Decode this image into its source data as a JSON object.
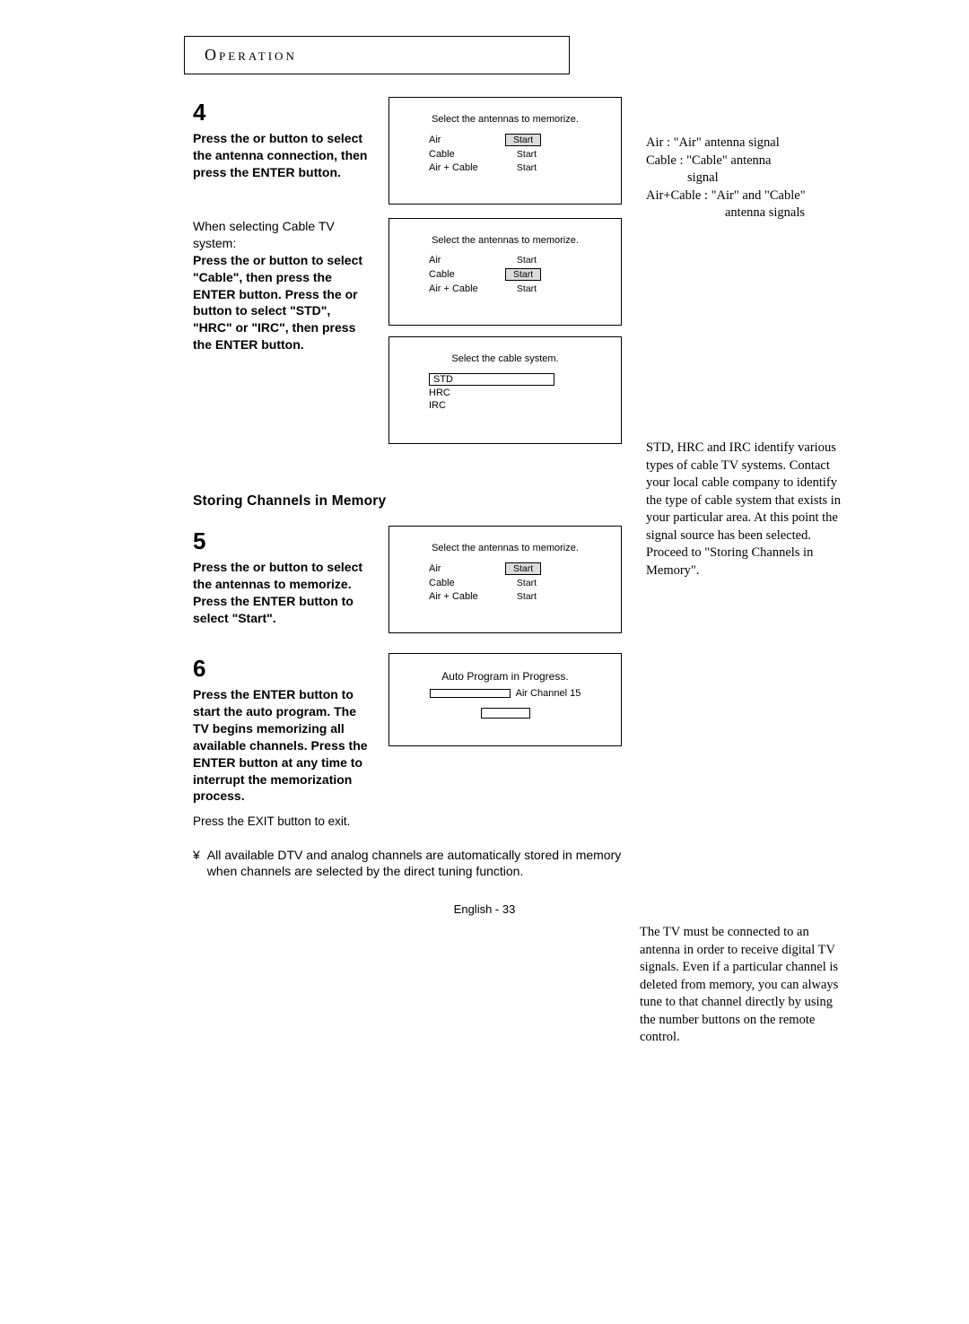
{
  "header": {
    "title": "Operation"
  },
  "sideNote1": {
    "line1": "Air : \"Air\" antenna signal",
    "line2": "Cable : \"Cable\" antenna",
    "line2b": "signal",
    "line3": "Air+Cable : \"Air\" and \"Cable\"",
    "line3b": "antenna signals"
  },
  "sideNote2": "STD, HRC and IRC identify various types of cable TV systems. Contact your local cable company to identify the type of cable system that exists in your particular area. At this point the signal source has been selected. Proceed to \"Storing Channels in Memory\".",
  "sideNote3": "The TV must be connected to an antenna in order to receive digital TV signals. Even if a particular channel is deleted from memory, you can always tune to that channel directly by using the number buttons on the remote control.",
  "step4": {
    "num": "4",
    "text": "Press the    or    button to select the antenna connection, then press the ENTER button."
  },
  "step4b": {
    "line1": "When selecting Cable TV system:",
    "text": "Press the    or    button to select \"Cable\", then press the ENTER button. Press the    or    button to select \"STD\", \"HRC\" or \"IRC\", then press the ENTER button."
  },
  "step5": {
    "num": "5",
    "text": "Press the    or button to select the antennas to memorize. Press the ENTER button to select \"Start\"."
  },
  "step6": {
    "num": "6",
    "text": "Press the ENTER button to start the auto program. The TV begins memorizing all available channels. Press the ENTER button at any time to interrupt the memorization process.",
    "exit": "Press the EXIT button to exit."
  },
  "screens": {
    "antennaTitle": "Select the antennas to memorize.",
    "antennas": [
      "Air",
      "Cable",
      "Air + Cable"
    ],
    "start": "Start",
    "cableTitle": "Select the cable system.",
    "cableOptions": [
      "STD",
      "HRC",
      "IRC"
    ],
    "progressTitle": "Auto Program in Progress.",
    "progressChannel": "Air Channel 15"
  },
  "subHeader": "Storing Channels in Memory",
  "bottomBullet": "¥",
  "bottomNote": "All available DTV and analog channels are automatically stored in memory when channels are selected by the direct tuning function.",
  "pageNum": "English - 33"
}
